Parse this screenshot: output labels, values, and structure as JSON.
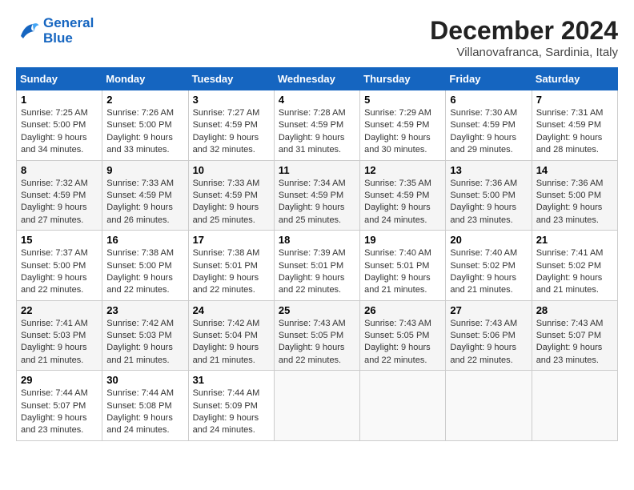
{
  "logo": {
    "line1": "General",
    "line2": "Blue"
  },
  "title": "December 2024",
  "location": "Villanovafranca, Sardinia, Italy",
  "days_header": [
    "Sunday",
    "Monday",
    "Tuesday",
    "Wednesday",
    "Thursday",
    "Friday",
    "Saturday"
  ],
  "weeks": [
    [
      {
        "day": "1",
        "sunrise": "7:25 AM",
        "sunset": "5:00 PM",
        "daylight": "9 hours and 34 minutes."
      },
      {
        "day": "2",
        "sunrise": "7:26 AM",
        "sunset": "5:00 PM",
        "daylight": "9 hours and 33 minutes."
      },
      {
        "day": "3",
        "sunrise": "7:27 AM",
        "sunset": "4:59 PM",
        "daylight": "9 hours and 32 minutes."
      },
      {
        "day": "4",
        "sunrise": "7:28 AM",
        "sunset": "4:59 PM",
        "daylight": "9 hours and 31 minutes."
      },
      {
        "day": "5",
        "sunrise": "7:29 AM",
        "sunset": "4:59 PM",
        "daylight": "9 hours and 30 minutes."
      },
      {
        "day": "6",
        "sunrise": "7:30 AM",
        "sunset": "4:59 PM",
        "daylight": "9 hours and 29 minutes."
      },
      {
        "day": "7",
        "sunrise": "7:31 AM",
        "sunset": "4:59 PM",
        "daylight": "9 hours and 28 minutes."
      }
    ],
    [
      {
        "day": "8",
        "sunrise": "7:32 AM",
        "sunset": "4:59 PM",
        "daylight": "9 hours and 27 minutes."
      },
      {
        "day": "9",
        "sunrise": "7:33 AM",
        "sunset": "4:59 PM",
        "daylight": "9 hours and 26 minutes."
      },
      {
        "day": "10",
        "sunrise": "7:33 AM",
        "sunset": "4:59 PM",
        "daylight": "9 hours and 25 minutes."
      },
      {
        "day": "11",
        "sunrise": "7:34 AM",
        "sunset": "4:59 PM",
        "daylight": "9 hours and 25 minutes."
      },
      {
        "day": "12",
        "sunrise": "7:35 AM",
        "sunset": "4:59 PM",
        "daylight": "9 hours and 24 minutes."
      },
      {
        "day": "13",
        "sunrise": "7:36 AM",
        "sunset": "5:00 PM",
        "daylight": "9 hours and 23 minutes."
      },
      {
        "day": "14",
        "sunrise": "7:36 AM",
        "sunset": "5:00 PM",
        "daylight": "9 hours and 23 minutes."
      }
    ],
    [
      {
        "day": "15",
        "sunrise": "7:37 AM",
        "sunset": "5:00 PM",
        "daylight": "9 hours and 22 minutes."
      },
      {
        "day": "16",
        "sunrise": "7:38 AM",
        "sunset": "5:00 PM",
        "daylight": "9 hours and 22 minutes."
      },
      {
        "day": "17",
        "sunrise": "7:38 AM",
        "sunset": "5:01 PM",
        "daylight": "9 hours and 22 minutes."
      },
      {
        "day": "18",
        "sunrise": "7:39 AM",
        "sunset": "5:01 PM",
        "daylight": "9 hours and 22 minutes."
      },
      {
        "day": "19",
        "sunrise": "7:40 AM",
        "sunset": "5:01 PM",
        "daylight": "9 hours and 21 minutes."
      },
      {
        "day": "20",
        "sunrise": "7:40 AM",
        "sunset": "5:02 PM",
        "daylight": "9 hours and 21 minutes."
      },
      {
        "day": "21",
        "sunrise": "7:41 AM",
        "sunset": "5:02 PM",
        "daylight": "9 hours and 21 minutes."
      }
    ],
    [
      {
        "day": "22",
        "sunrise": "7:41 AM",
        "sunset": "5:03 PM",
        "daylight": "9 hours and 21 minutes."
      },
      {
        "day": "23",
        "sunrise": "7:42 AM",
        "sunset": "5:03 PM",
        "daylight": "9 hours and 21 minutes."
      },
      {
        "day": "24",
        "sunrise": "7:42 AM",
        "sunset": "5:04 PM",
        "daylight": "9 hours and 21 minutes."
      },
      {
        "day": "25",
        "sunrise": "7:43 AM",
        "sunset": "5:05 PM",
        "daylight": "9 hours and 22 minutes."
      },
      {
        "day": "26",
        "sunrise": "7:43 AM",
        "sunset": "5:05 PM",
        "daylight": "9 hours and 22 minutes."
      },
      {
        "day": "27",
        "sunrise": "7:43 AM",
        "sunset": "5:06 PM",
        "daylight": "9 hours and 22 minutes."
      },
      {
        "day": "28",
        "sunrise": "7:43 AM",
        "sunset": "5:07 PM",
        "daylight": "9 hours and 23 minutes."
      }
    ],
    [
      {
        "day": "29",
        "sunrise": "7:44 AM",
        "sunset": "5:07 PM",
        "daylight": "9 hours and 23 minutes."
      },
      {
        "day": "30",
        "sunrise": "7:44 AM",
        "sunset": "5:08 PM",
        "daylight": "9 hours and 24 minutes."
      },
      {
        "day": "31",
        "sunrise": "7:44 AM",
        "sunset": "5:09 PM",
        "daylight": "9 hours and 24 minutes."
      },
      null,
      null,
      null,
      null
    ]
  ]
}
